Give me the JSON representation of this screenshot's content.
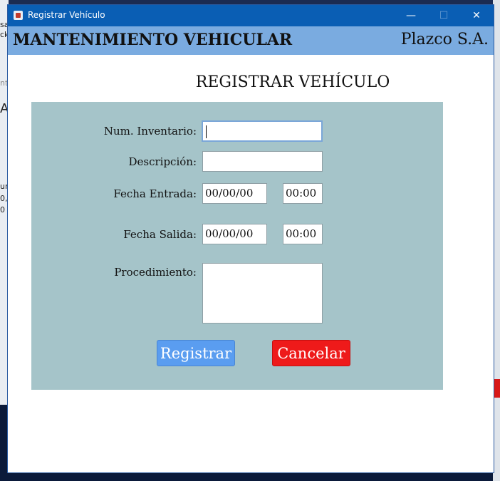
{
  "window": {
    "title": "Registrar Vehículo",
    "minimize": "—",
    "maximize": "☐",
    "close": "✕"
  },
  "header": {
    "title": "MANTENIMIENTO VEHICULAR",
    "company": "Plazco S.A."
  },
  "form": {
    "title": "REGISTRAR VEHÍCULO",
    "inventario_label": "Num. Inventario:",
    "inventario_value": "",
    "descripcion_label": "Descripción:",
    "descripcion_value": "",
    "entrada_label": "Fecha Entrada:",
    "entrada_fecha": "00/00/00",
    "entrada_hora": "00:00",
    "salida_label": "Fecha Salida:",
    "salida_fecha": "00/00/00",
    "salida_hora": "00:00",
    "procedimiento_label": "Procedimiento:",
    "procedimiento_value": "",
    "register_button": "Registrar",
    "cancel_button": "Cancelar"
  },
  "background": {
    "fragments": [
      "sa",
      "ck",
      "nt",
      "A",
      "ur",
      "0,",
      "0"
    ]
  },
  "colors": {
    "titlebar": "#0a5eb4",
    "header": "#7aabe0",
    "panel": "#a5c4c9",
    "register": "#5a9df0",
    "cancel": "#ee1a1a"
  }
}
